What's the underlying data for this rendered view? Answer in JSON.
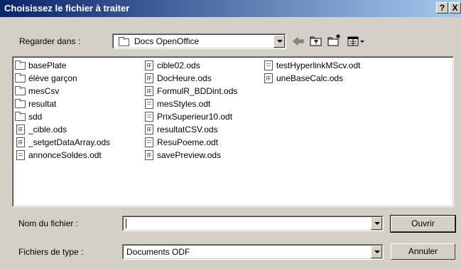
{
  "window": {
    "title": "Choisissez le fichier à traiter",
    "help_label": "?",
    "close_label": "X"
  },
  "lookin": {
    "label": "Regarder dans :",
    "value": "Docs OpenOffice"
  },
  "toolbar": {
    "back_icon": "back-arrow-icon",
    "up_icon": "up-folder-icon",
    "new_folder_icon": "new-folder-icon",
    "view_menu_icon": "view-menu-icon"
  },
  "files": {
    "col1": [
      {
        "name": "basePlate",
        "type": "folder"
      },
      {
        "name": "élève garçon",
        "type": "folder"
      },
      {
        "name": "mesCsv",
        "type": "folder"
      },
      {
        "name": "resultat",
        "type": "folder"
      },
      {
        "name": "sdd",
        "type": "folder"
      },
      {
        "name": "_cible.ods",
        "type": "calc"
      },
      {
        "name": "_setgetDataArray.ods",
        "type": "calc"
      },
      {
        "name": "annonceSoldes.odt",
        "type": "writer"
      }
    ],
    "col2": [
      {
        "name": "cible02.ods",
        "type": "calc"
      },
      {
        "name": "DocHeure.ods",
        "type": "calc"
      },
      {
        "name": "FormulR_BDDint.ods",
        "type": "calc"
      },
      {
        "name": "mesStyles.odt",
        "type": "writer"
      },
      {
        "name": "PrixSuperieur10.odt",
        "type": "writer"
      },
      {
        "name": "resultatCSV.ods",
        "type": "calc"
      },
      {
        "name": "ResuPoeme.odt",
        "type": "writer"
      },
      {
        "name": "savePreview.ods",
        "type": "calc"
      }
    ],
    "col3": [
      {
        "name": "testHyperlinkMScv.odt",
        "type": "writer"
      },
      {
        "name": "uneBaseCalc.ods",
        "type": "calc"
      }
    ]
  },
  "filename": {
    "label": "Nom du fichier :",
    "value": ""
  },
  "filetype": {
    "label": "Fichiers de type :",
    "value": "Documents ODF"
  },
  "buttons": {
    "open": "Ouvrir",
    "cancel": "Annuler"
  }
}
